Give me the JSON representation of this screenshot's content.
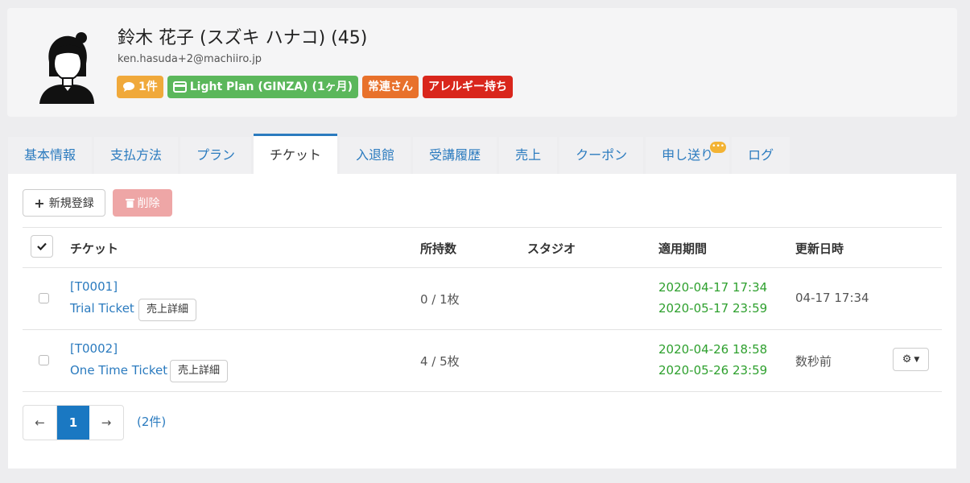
{
  "profile": {
    "name": "鈴木 花子 (スズキ ハナコ) (45)",
    "email": "ken.hasuda+2@machiiro.jp",
    "badges": [
      {
        "label": "1件",
        "icon": "comment-icon",
        "color": "#f0a93b"
      },
      {
        "label": "Light Plan (GINZA) (1ヶ月)",
        "icon": "card-icon",
        "color": "#5bb75b"
      },
      {
        "label": "常連さん",
        "color": "#e8712b"
      },
      {
        "label": "アレルギー持ち",
        "color": "#d9261c"
      }
    ]
  },
  "tabs": [
    {
      "label": "基本情報"
    },
    {
      "label": "支払方法"
    },
    {
      "label": "プラン"
    },
    {
      "label": "チケット",
      "active": true
    },
    {
      "label": "入退館"
    },
    {
      "label": "受講履歴"
    },
    {
      "label": "売上"
    },
    {
      "label": "クーポン"
    },
    {
      "label": "申し送り",
      "notification": "•••"
    },
    {
      "label": "ログ"
    }
  ],
  "toolbar": {
    "new_label": "新規登録",
    "delete_label": "削除"
  },
  "table": {
    "headers": {
      "ticket": "チケット",
      "owned": "所持数",
      "studio": "スタジオ",
      "period": "適用期間",
      "updated": "更新日時"
    },
    "rows": [
      {
        "code": "[T0001]",
        "name": "Trial Ticket",
        "detail": "売上詳細",
        "owned": "0 / 1枚",
        "studio": "",
        "start": "2020-04-17 17:34",
        "end": "2020-05-17 23:59",
        "updated": "04-17 17:34"
      },
      {
        "code": "[T0002]",
        "name": "One Time Ticket",
        "detail": "売上詳細",
        "owned": "4 / 5枚",
        "studio": "",
        "start": "2020-04-26 18:58",
        "end": "2020-05-26 23:59",
        "updated": "数秒前"
      }
    ]
  },
  "pagination": {
    "prev": "←",
    "current": "1",
    "next": "→",
    "count": "(2件)"
  },
  "colors": {
    "accent": "#1a78c2",
    "link": "#2b7bbf",
    "period_green": "#2ea02e",
    "delete_disabled": "#eea6a6"
  }
}
